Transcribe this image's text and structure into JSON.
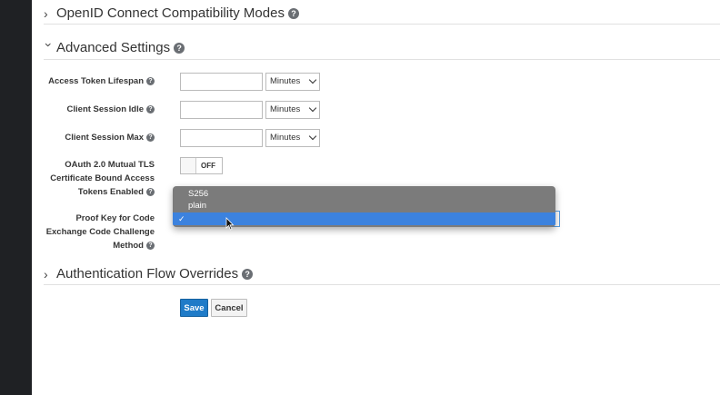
{
  "sections": {
    "openid": {
      "title": "OpenID Connect Compatibility Modes",
      "expanded": false
    },
    "advanced": {
      "title": "Advanced Settings",
      "expanded": true
    },
    "auth_flow": {
      "title": "Authentication Flow Overrides",
      "expanded": false
    }
  },
  "fields": {
    "access_token_lifespan": {
      "label": "Access Token Lifespan",
      "value": "",
      "unit": "Minutes"
    },
    "client_session_idle": {
      "label": "Client Session Idle",
      "value": "",
      "unit": "Minutes"
    },
    "client_session_max": {
      "label": "Client Session Max",
      "value": "",
      "unit": "Minutes"
    },
    "oauth_mtls": {
      "label_line1": "OAuth 2.0 Mutual TLS",
      "label_line2": "Certificate Bound Access",
      "label_line3": "Tokens Enabled",
      "toggle_text": "OFF"
    },
    "pkce": {
      "label_line1": "Proof Key for Code",
      "label_line2": "Exchange Code Challenge",
      "label_line3": "Method",
      "options": [
        "S256",
        "plain",
        ""
      ],
      "selected_index": 2,
      "check_glyph": "✓"
    }
  },
  "buttons": {
    "save": "Save",
    "cancel": "Cancel"
  },
  "help_glyph": "?",
  "colors": {
    "primary": "#1f7bc8",
    "highlight": "#3c82de",
    "dropdown_bg": "#7b7b7b",
    "left_rail": "#1f2124"
  }
}
